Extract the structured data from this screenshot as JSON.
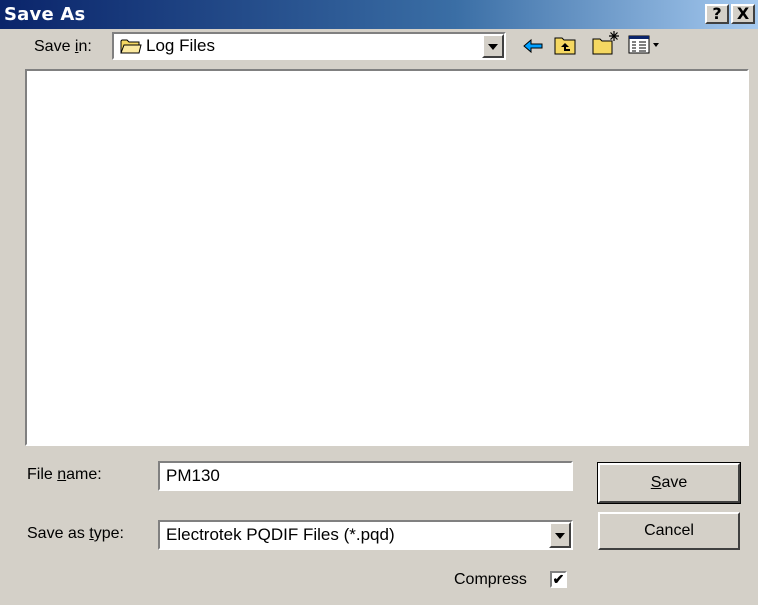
{
  "window": {
    "title": "Save As",
    "help_button": "?",
    "close_button": "X"
  },
  "save_in": {
    "label_pre": "Save ",
    "label_accel": "i",
    "label_post": "n:",
    "value": "Log Files"
  },
  "toolbar": {
    "back_icon": "back-arrow-icon",
    "up_icon": "up-one-level-icon",
    "new_folder_icon": "create-new-folder-icon",
    "view_icon": "view-menu-icon"
  },
  "file_name": {
    "label_pre": "File ",
    "label_accel": "n",
    "label_post": "ame:",
    "value": "PM130"
  },
  "save_as_type": {
    "label_pre": "Save as ",
    "label_accel": "t",
    "label_post": "ype:",
    "value": "Electrotek PQDIF Files (*.pqd)"
  },
  "buttons": {
    "save_accel": "S",
    "save_rest": "ave",
    "cancel": "Cancel"
  },
  "compress": {
    "label": "Compress",
    "checked": true,
    "check_glyph": "✔"
  },
  "colors": {
    "title_bar_start": "#0a246a",
    "title_bar_end": "#a6caf0",
    "dialog_face": "#d4d0c8",
    "folder_yellow": "#f5d862",
    "back_arrow": "#00a0ff"
  }
}
